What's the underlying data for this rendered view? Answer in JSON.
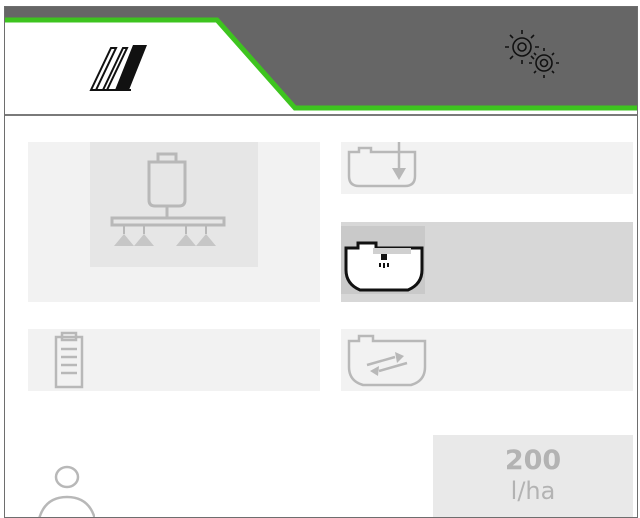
{
  "header": {
    "tabs": [
      {
        "id": "field",
        "icon": "field-tramline-icon",
        "active": true
      },
      {
        "id": "settings",
        "icon": "gears-icon",
        "active": false
      }
    ],
    "accent_color": "#3ec41f",
    "inactive_tab_color": "#666666"
  },
  "menu": {
    "tiles": [
      {
        "id": "sprayer",
        "icon": "sprayer-boom-icon"
      },
      {
        "id": "tank-fill",
        "icon": "tank-fill-icon"
      },
      {
        "id": "tank-spray",
        "icon": "tank-spray-icon",
        "selected": true
      },
      {
        "id": "documentation",
        "icon": "clipboard-icon"
      },
      {
        "id": "tank-circulation",
        "icon": "tank-circulation-icon"
      }
    ]
  },
  "application_rate": {
    "value": "200",
    "unit": "l/ha"
  },
  "user": {
    "icon": "user-icon"
  }
}
